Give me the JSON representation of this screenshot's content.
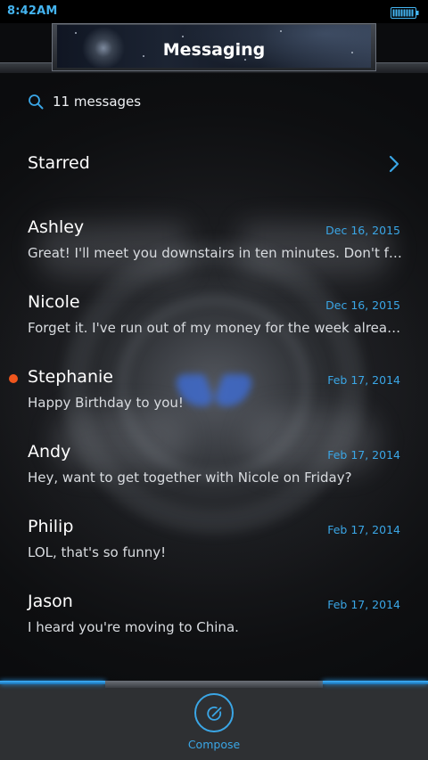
{
  "status_bar": {
    "time": "8:42AM",
    "battery_icon": "battery-full-icon"
  },
  "header": {
    "title": "Messaging"
  },
  "search": {
    "icon": "search-icon",
    "label": "11 messages"
  },
  "starred": {
    "label": "Starred",
    "icon": "chevron-right-icon"
  },
  "messages": [
    {
      "name": "Ashley",
      "date": "Dec 16, 2015",
      "preview": "Great! I'll meet you downstairs in ten minutes. Don't forget your umbrella.",
      "unread": false
    },
    {
      "name": "Nicole",
      "date": "Dec 16, 2015",
      "preview": "Forget it. I've run out of my money for the week already.",
      "unread": false
    },
    {
      "name": "Stephanie",
      "date": "Feb 17, 2014",
      "preview": "Happy Birthday to you!",
      "unread": true
    },
    {
      "name": "Andy",
      "date": "Feb 17, 2014",
      "preview": "Hey, want to get together with Nicole on Friday?",
      "unread": false
    },
    {
      "name": "Philip",
      "date": "Feb 17, 2014",
      "preview": "LOL, that's so funny!",
      "unread": false
    },
    {
      "name": "Jason",
      "date": "Feb 17, 2014",
      "preview": "I heard you're moving to China.",
      "unread": false
    }
  ],
  "bottom_bar": {
    "compose_label": "Compose",
    "compose_icon": "compose-icon"
  },
  "colors": {
    "accent": "#3aa6e6",
    "unread": "#f0561d",
    "background": "#0b0c0e"
  }
}
